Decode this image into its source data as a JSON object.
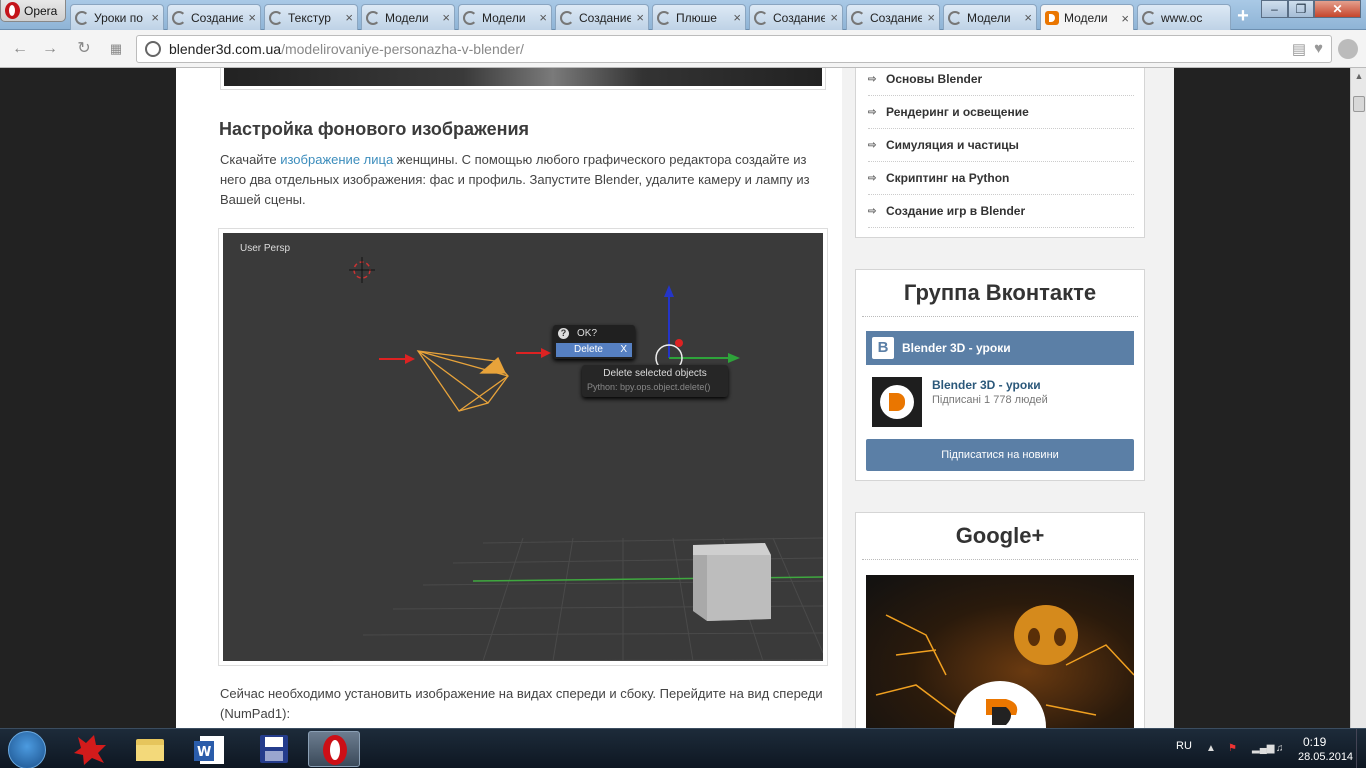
{
  "browser": {
    "menu_label": "Opera",
    "tabs": [
      {
        "title": "Уроки по",
        "icon": "loading-icon"
      },
      {
        "title": "Создание",
        "icon": "loading-icon"
      },
      {
        "title": "Текстур",
        "icon": "loading-icon"
      },
      {
        "title": "Модели",
        "icon": "loading-icon"
      },
      {
        "title": "Модели",
        "icon": "loading-icon"
      },
      {
        "title": "Создание",
        "icon": "loading-icon"
      },
      {
        "title": "Плюше",
        "icon": "loading-icon"
      },
      {
        "title": "Создание",
        "icon": "loading-icon"
      },
      {
        "title": "Создание",
        "icon": "loading-icon"
      },
      {
        "title": "Модели",
        "icon": "loading-icon"
      },
      {
        "title": "Модели",
        "icon": "blender-icon",
        "active": true
      },
      {
        "title": "www.oc",
        "icon": "loading-icon"
      }
    ],
    "new_tab": "+",
    "tab_close": "×",
    "window": {
      "minimize": "–",
      "maximize": "❐",
      "close": "✕"
    },
    "url_host": "blender3d.com.ua",
    "url_path": "/modelirovaniye-personazha-v-blender/"
  },
  "article": {
    "heading": "Настройка фонового изображения",
    "para1_before": "Скачайте ",
    "para1_link": "изображение лица",
    "para1_after": " женщины. С помощью любого графического редактора создайте из него два отдельных изображения: фас и профиль. Запустите Blender, удалите камеру и лампу из Вашей сцены.",
    "screenshot": {
      "view_label": "User Persp",
      "popup_title": "OK?",
      "popup_button": "Delete",
      "popup_shortcut": "X",
      "tooltip_title": "Delete selected objects",
      "tooltip_python": "Python: bpy.ops.object.delete()"
    },
    "para2": "Сейчас необходимо установить изображение на видах спереди и сбоку. Перейдите на вид спереди (NumPad1):"
  },
  "sidebar": {
    "categories": [
      "Основы Blender",
      "Рендеринг и освещение",
      "Симуляция и частицы",
      "Скриптинг на Python",
      "Создание игр в Blender"
    ],
    "vk": {
      "title": "Группа Вконтакте",
      "logo": "B",
      "group_header": "Blender 3D - уроки",
      "group_name": "Blender 3D - уроки",
      "subscribers": "Підписані 1 778 людей",
      "subscribe_button": "Підписатися на новини"
    },
    "gplus": {
      "title": "Google+"
    }
  },
  "taskbar": {
    "language": "RU",
    "time": "0:19",
    "date": "28.05.2014"
  },
  "colors": {
    "accent": "#ea7600",
    "link": "#3c8dbc",
    "vk": "#5b7fa6"
  }
}
